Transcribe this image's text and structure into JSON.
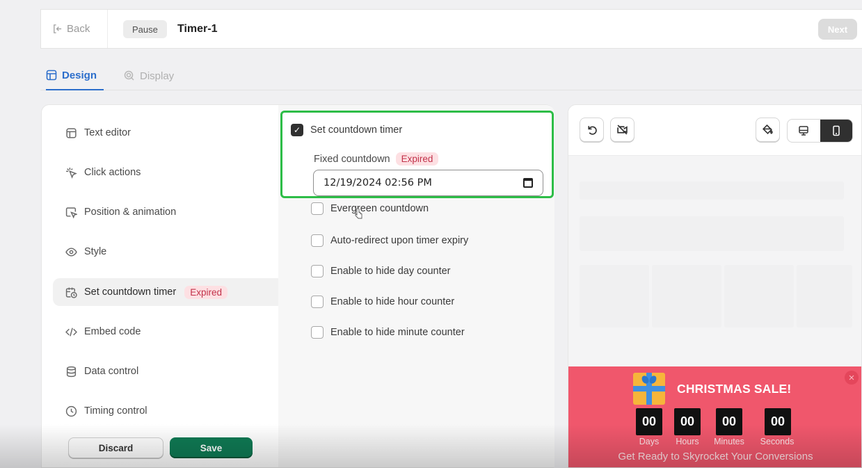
{
  "header": {
    "back_label": "Back",
    "status_badge": "Pause",
    "title": "Timer-1",
    "next_label": "Next"
  },
  "tabs": [
    {
      "label": "Design",
      "active": true
    },
    {
      "label": "Display",
      "active": false
    }
  ],
  "sidebar": {
    "items": [
      {
        "label": "Text editor",
        "icon": "layout-icon"
      },
      {
        "label": "Click actions",
        "icon": "click-icon"
      },
      {
        "label": "Position & animation",
        "icon": "cursor-box-icon"
      },
      {
        "label": "Style",
        "icon": "eye-icon"
      },
      {
        "label": "Set countdown timer",
        "icon": "calendar-clock-icon",
        "badge": "Expired",
        "selected": true
      },
      {
        "label": "Embed code",
        "icon": "code-icon"
      },
      {
        "label": "Data control",
        "icon": "database-icon"
      },
      {
        "label": "Timing control",
        "icon": "clock-icon"
      }
    ],
    "discard_label": "Discard",
    "save_label": "Save"
  },
  "settings": {
    "set_timer": {
      "label": "Set countdown timer",
      "checked": true
    },
    "fixed_label": "Fixed countdown",
    "fixed_badge": "Expired",
    "date_value": "12/19/2024 02:56 PM",
    "options": [
      {
        "label": "Evergreen countdown",
        "checked": false
      },
      {
        "label": "Auto-redirect upon timer expiry",
        "checked": false
      },
      {
        "label": "Enable to hide day counter",
        "checked": false
      },
      {
        "label": "Enable to hide hour counter",
        "checked": false
      },
      {
        "label": "Enable to hide minute counter",
        "checked": false
      }
    ]
  },
  "preview": {
    "promo": {
      "title": "CHRISTMAS SALE!",
      "counters": [
        {
          "value": "00",
          "label": "Days"
        },
        {
          "value": "00",
          "label": "Hours"
        },
        {
          "value": "00",
          "label": "Minutes"
        },
        {
          "value": "00",
          "label": "Seconds"
        }
      ],
      "subtitle": "Get Ready to Skyrocket Your Conversions",
      "close_glyph": "×"
    }
  },
  "colors": {
    "accent_blue": "#2c6ecb",
    "save_green": "#0f7a54",
    "highlight_green": "#2dbd47",
    "promo_red": "#f0576c",
    "expired_bg": "#fde0e3",
    "expired_text": "#c2324a"
  }
}
